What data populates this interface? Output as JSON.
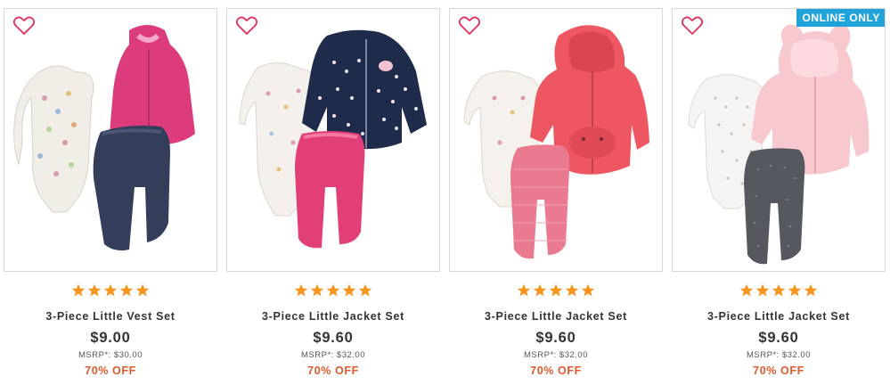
{
  "colors": {
    "heart": "#e0325c",
    "star": "#f7941d",
    "badge": "#1fa3d9",
    "discount": "#e4582b"
  },
  "products": [
    {
      "name": "3-Piece Little Vest Set",
      "price": "$9.00",
      "msrp": "MSRP*: $30.00",
      "discount": "70% OFF",
      "rating": 5,
      "badge": ""
    },
    {
      "name": "3-Piece Little Jacket Set",
      "price": "$9.60",
      "msrp": "MSRP*: $32.00",
      "discount": "70% OFF",
      "rating": 5,
      "badge": ""
    },
    {
      "name": "3-Piece Little Jacket Set",
      "price": "$9.60",
      "msrp": "MSRP*: $32.00",
      "discount": "70% OFF",
      "rating": 5,
      "badge": ""
    },
    {
      "name": "3-Piece Little Jacket Set",
      "price": "$9.60",
      "msrp": "MSRP*: $32.00",
      "discount": "70% OFF",
      "rating": 5,
      "badge": "ONLINE ONLY"
    }
  ]
}
